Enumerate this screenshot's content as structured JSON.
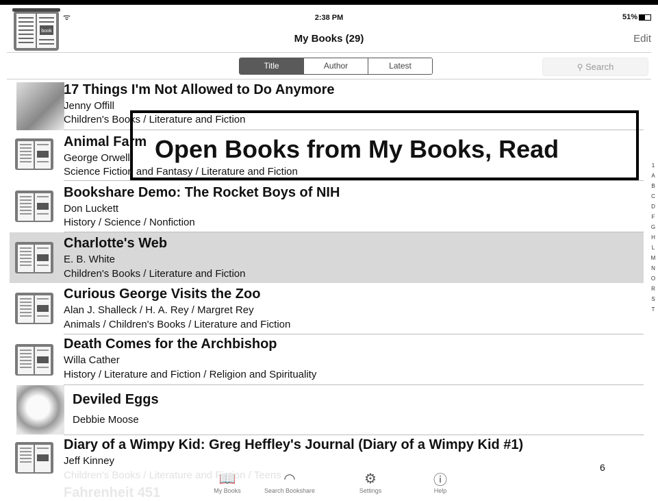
{
  "status_bar": {
    "time": "2:38 PM",
    "battery": "51%",
    "wifi": "ᯤ"
  },
  "navbar": {
    "title": "My Books (29)",
    "edit_label": "Edit",
    "logo_label": "book"
  },
  "segments": [
    {
      "label": "Title",
      "active": true
    },
    {
      "label": "Author",
      "active": false
    },
    {
      "label": "Latest",
      "active": false
    }
  ],
  "search": {
    "placeholder": "Search",
    "icon": "search-icon"
  },
  "callout": "Open Books from My Books, Read",
  "books": [
    {
      "title": "17 Things I'm Not Allowed to Do Anymore",
      "author": "Jenny Offill",
      "category": "Children's Books / Literature and Fiction",
      "thumb": "cover",
      "selected": false
    },
    {
      "title": "Animal Farm",
      "author": "George Orwell",
      "category": "Science Fiction and Fantasy / Literature and Fiction",
      "thumb": "book",
      "selected": false
    },
    {
      "title": "Bookshare Demo: The Rocket Boys of NIH",
      "author": "Don Luckett",
      "category": "History / Science / Nonfiction",
      "thumb": "book",
      "selected": false
    },
    {
      "title": "Charlotte's Web",
      "author": "E. B. White",
      "category": "Children's Books / Literature and Fiction",
      "thumb": "book",
      "selected": true
    },
    {
      "title": "Curious George Visits the Zoo",
      "author": "Alan J. Shalleck / H. A. Rey / Margret Rey",
      "category": "Animals / Children's Books / Literature and Fiction",
      "thumb": "book",
      "selected": false
    },
    {
      "title": "Death Comes for the Archbishop",
      "author": "Willa Cather",
      "category": "History / Literature and Fiction / Religion and Spirituality",
      "thumb": "book",
      "selected": false
    },
    {
      "title": "Deviled Eggs",
      "author": "Debbie Moose",
      "category": "",
      "thumb": "photo",
      "selected": false
    },
    {
      "title": "Diary of a Wimpy Kid: Greg Heffley's Journal (Diary of a Wimpy Kid #1)",
      "author": "Jeff Kinney",
      "category": "Children's Books / Literature and Fiction / Teens",
      "thumb": "book",
      "selected": false
    }
  ],
  "faded_next_title": "Fahrenheit 451",
  "index_letters": [
    "1",
    "A",
    "B",
    "C",
    "D",
    "F",
    "G",
    "H",
    "L",
    "M",
    "N",
    "O",
    "R",
    "S",
    "T"
  ],
  "tabs": [
    {
      "label": "My Books",
      "icon": "book-open-icon"
    },
    {
      "label": "Search Bookshare",
      "icon": "rainbow-icon"
    },
    {
      "label": "Settings",
      "icon": "gear-icon"
    },
    {
      "label": "Help",
      "icon": "question-icon"
    }
  ],
  "page_number": "6"
}
